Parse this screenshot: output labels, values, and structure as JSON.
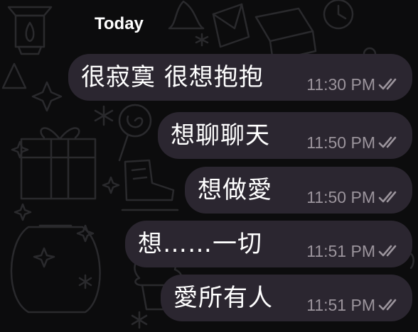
{
  "chat": {
    "day_separator": "Today",
    "messages": [
      {
        "text": "很寂寞 很想抱抱",
        "time": "11:30 PM",
        "status_icon": "double-check-icon"
      },
      {
        "text": "想聊聊天",
        "time": "11:50 PM",
        "status_icon": "double-check-icon"
      },
      {
        "text": "想做愛",
        "time": "11:50 PM",
        "status_icon": "double-check-icon"
      },
      {
        "text": "想……一切",
        "time": "11:51 PM",
        "status_icon": "double-check-icon"
      },
      {
        "text": "愛所有人",
        "time": "11:51 PM",
        "status_icon": "double-check-icon"
      }
    ]
  },
  "colors": {
    "background": "#0c0c0d",
    "bubble": "#2b2630",
    "text": "#ffffff",
    "meta": "#9b949c",
    "doodle": "#2a2a2d"
  }
}
